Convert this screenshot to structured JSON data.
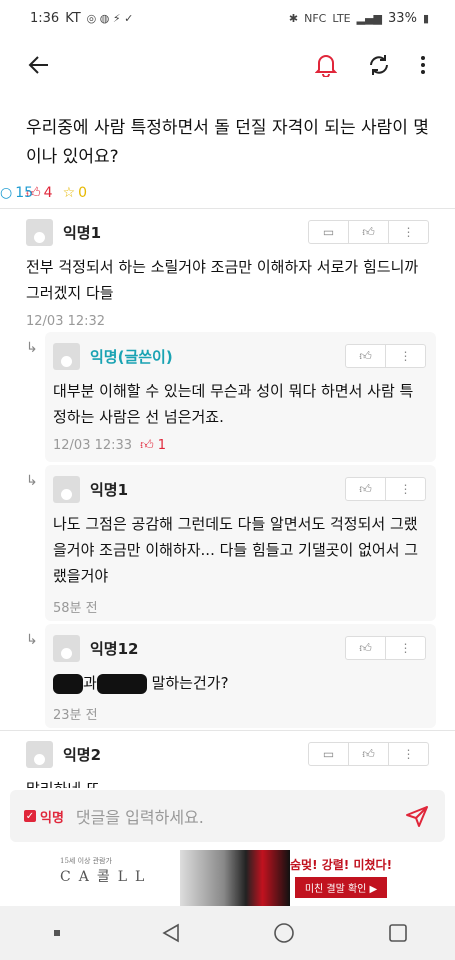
{
  "status": {
    "time": "1:36",
    "carrier": "KT",
    "network": "LTE",
    "battery": "33%",
    "nfc": "NFC"
  },
  "header": {
    "back_icon": "back-arrow-icon",
    "bell_icon": "bell-icon",
    "refresh_icon": "refresh-icon",
    "more_icon": "more-vertical-icon",
    "accent_color": "#e0263a"
  },
  "post": {
    "title": "우리중에 사람 특정하면서 돌 던질 자격이 되는 사람이 몇이나 있어요?",
    "likes": "4",
    "comments": "15",
    "scraps": "0"
  },
  "comments": [
    {
      "author": "익명1",
      "body": "전부 걱정되서 하는 소릴거야 조금만 이해하자 서로가 힘드니까 그러겠지 다들",
      "time": "12/03 12:32"
    },
    {
      "author": "익명(글쓴이)",
      "body": "대부분 이해할 수 있는데 무슨과 성이 뭐다 하면서 사람 특정하는 사람은 선 넘은거죠.",
      "time": "12/03 12:33",
      "likes": "1"
    },
    {
      "author": "익명1",
      "body": "나도 그점은 공감해 그런데도 다들 알면서도 걱정되서 그랬을거야 조금만 이해하자... 다들 힘들고 기댈곳이 없어서 그랬을거야",
      "time": "58분 전"
    },
    {
      "author": "익명12",
      "body_part1": "과",
      "body_part2": " 말하는건가?",
      "time": "23분 전"
    },
    {
      "author": "익명2",
      "body": "말리하네 또"
    }
  ],
  "input": {
    "anon_label": "익명",
    "placeholder": "댓글을 입력하세요."
  },
  "ad": {
    "small_text": "15세 이상 관람가",
    "title": "CA콜LL",
    "headline": "숨멎! 강렬! 미쳤다!",
    "button": "미친 결말 확인 ▶"
  }
}
